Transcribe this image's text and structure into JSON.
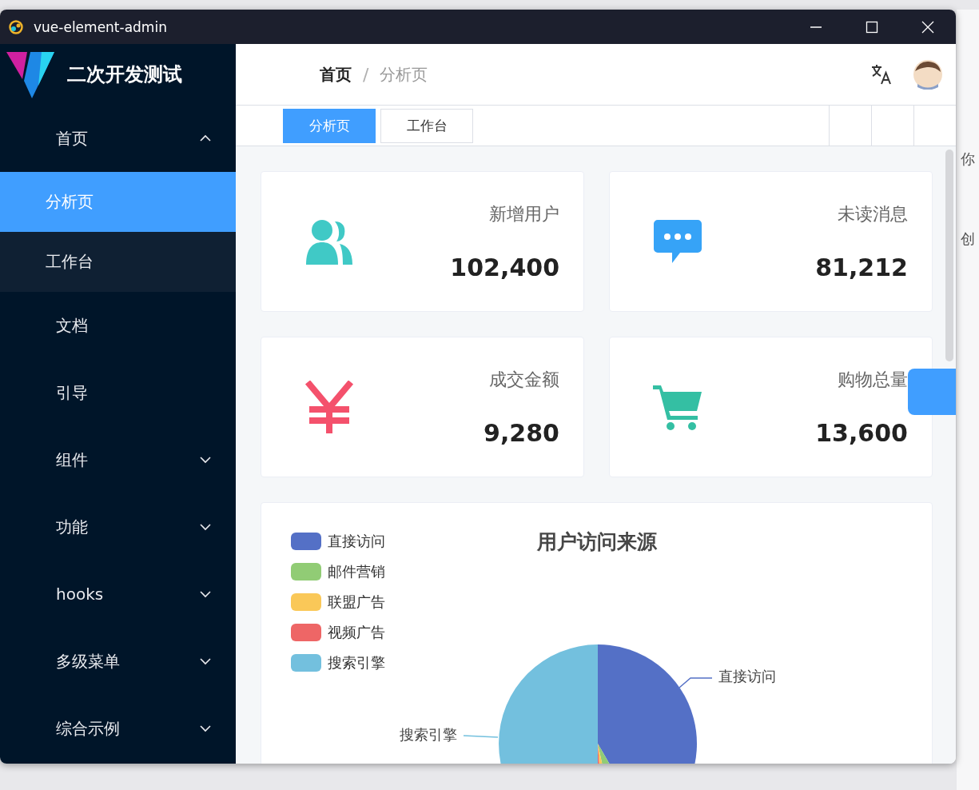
{
  "window": {
    "title": "vue-element-admin"
  },
  "sidebar": {
    "logo_text": "二次开发测试",
    "items": [
      {
        "label": "首页",
        "expanded": true,
        "children": [
          {
            "label": "分析页",
            "selected": true
          },
          {
            "label": "工作台",
            "selected": false
          }
        ]
      },
      {
        "label": "文档"
      },
      {
        "label": "引导"
      },
      {
        "label": "组件",
        "expanded": false
      },
      {
        "label": "功能",
        "expanded": false
      },
      {
        "label": "hooks",
        "expanded": false
      },
      {
        "label": "多级菜单",
        "expanded": false
      },
      {
        "label": "综合示例",
        "expanded": false
      }
    ]
  },
  "header": {
    "breadcrumb": [
      "首页",
      "分析页"
    ],
    "separator": "/"
  },
  "tabs": [
    {
      "label": "分析页",
      "selected": true
    },
    {
      "label": "工作台",
      "selected": false
    }
  ],
  "stat_cards": [
    {
      "kind": "users",
      "title": "新增用户",
      "value": "102,400"
    },
    {
      "kind": "message",
      "title": "未读消息",
      "value": "81,212"
    },
    {
      "kind": "money",
      "title": "成交金额",
      "value": "9,280"
    },
    {
      "kind": "cart",
      "title": "购物总量",
      "value": "13,600"
    }
  ],
  "chart": {
    "title": "用户访问来源",
    "legend": [
      {
        "name": "直接访问",
        "color": "#5470c6"
      },
      {
        "name": "邮件营销",
        "color": "#91cc75"
      },
      {
        "name": "联盟广告",
        "color": "#fac858"
      },
      {
        "name": "视频广告",
        "color": "#ee6666"
      },
      {
        "name": "搜索引擎",
        "color": "#73c0de"
      }
    ],
    "slice_labels": [
      "直接访问",
      "搜索引擎"
    ]
  },
  "background": {
    "texts": [
      "你",
      "创"
    ]
  }
}
